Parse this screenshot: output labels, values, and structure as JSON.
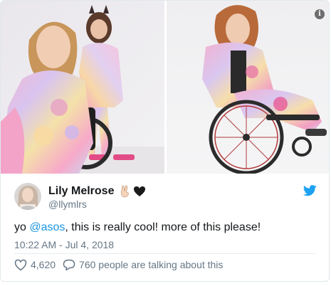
{
  "tweet": {
    "author_name": "Lily Melrose",
    "author_handle": "@llymlrs",
    "text_before": "yo ",
    "mention": "@asos",
    "text_after": ", this is really cool! more of this please!",
    "timestamp": "10:22 AM - Jul 4, 2018",
    "likes": "4,620",
    "replies_text": "760 people are talking about this"
  },
  "icons": {
    "info": "info-icon",
    "twitter": "twitter-bird-icon",
    "heart": "heart-outline-icon",
    "reply": "speech-bubble-icon",
    "name_emoji_1": "victory-hand-emoji",
    "name_emoji_2": "black-heart-emoji"
  },
  "colors": {
    "link": "#1b95e0",
    "secondary_text": "#657786",
    "primary_text": "#14171a",
    "twitter_blue": "#1da1f2"
  }
}
